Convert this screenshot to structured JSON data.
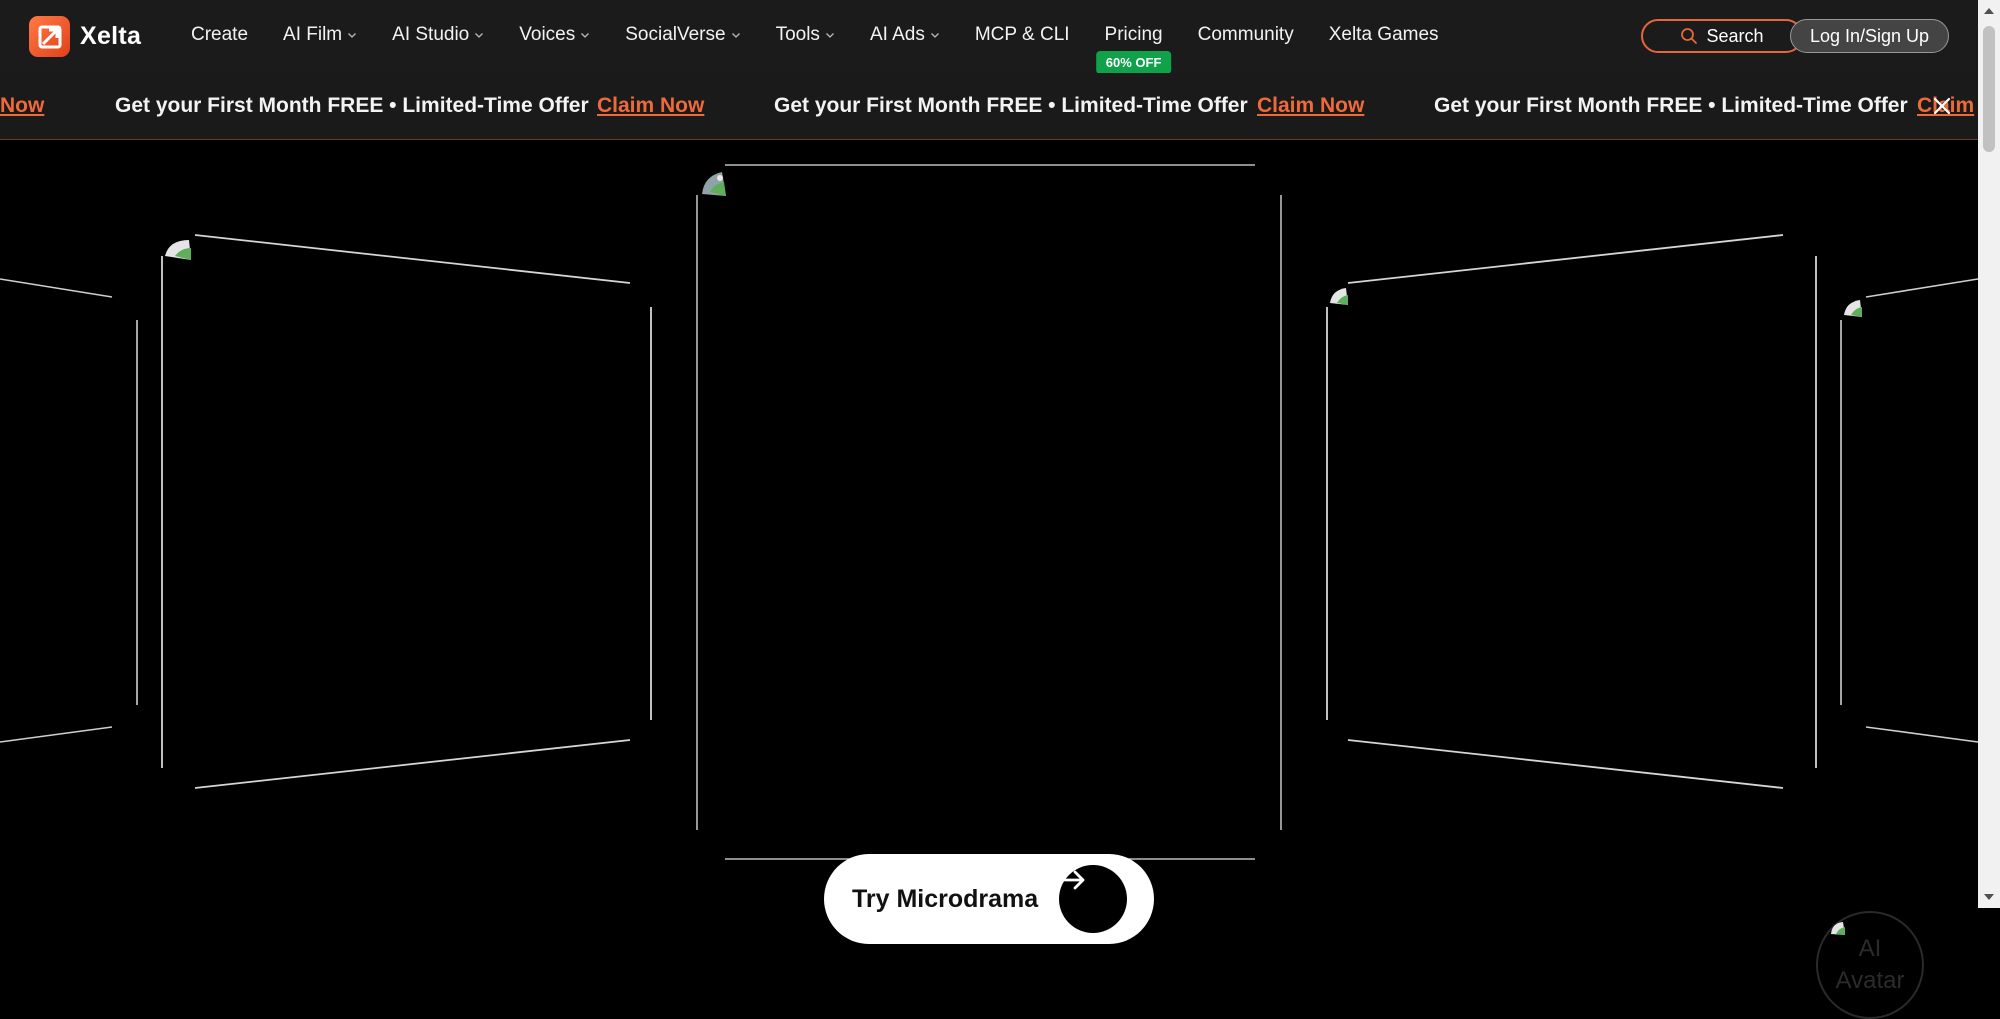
{
  "brand": {
    "name": "Xelta"
  },
  "nav": {
    "items": [
      {
        "label": "Create",
        "dropdown": false
      },
      {
        "label": "AI Film",
        "dropdown": true
      },
      {
        "label": "AI Studio",
        "dropdown": true
      },
      {
        "label": "Voices",
        "dropdown": true
      },
      {
        "label": "SocialVerse",
        "dropdown": true
      },
      {
        "label": "Tools",
        "dropdown": true
      },
      {
        "label": "AI Ads",
        "dropdown": true
      },
      {
        "label": "MCP & CLI",
        "dropdown": false
      },
      {
        "label": "Pricing",
        "dropdown": false,
        "badge": "60% OFF"
      },
      {
        "label": "Community",
        "dropdown": false
      },
      {
        "label": "Xelta Games",
        "dropdown": false
      }
    ],
    "search_label": "Search",
    "login_label": "Log In/Sign Up"
  },
  "promo": {
    "text": "Get your First Month FREE • Limited-Time Offer",
    "link_label": "Claim Now",
    "partial_start_link": "Now",
    "partial_end_link": "Claim"
  },
  "hero": {
    "cta_label": "Try Microdrama",
    "avatar_label": "AI Avatar"
  },
  "colors": {
    "nav_bg": "#1b1b1b",
    "accent": "#ef6a3a",
    "badge_green": "#0fa24a",
    "page_bg": "#000000"
  }
}
